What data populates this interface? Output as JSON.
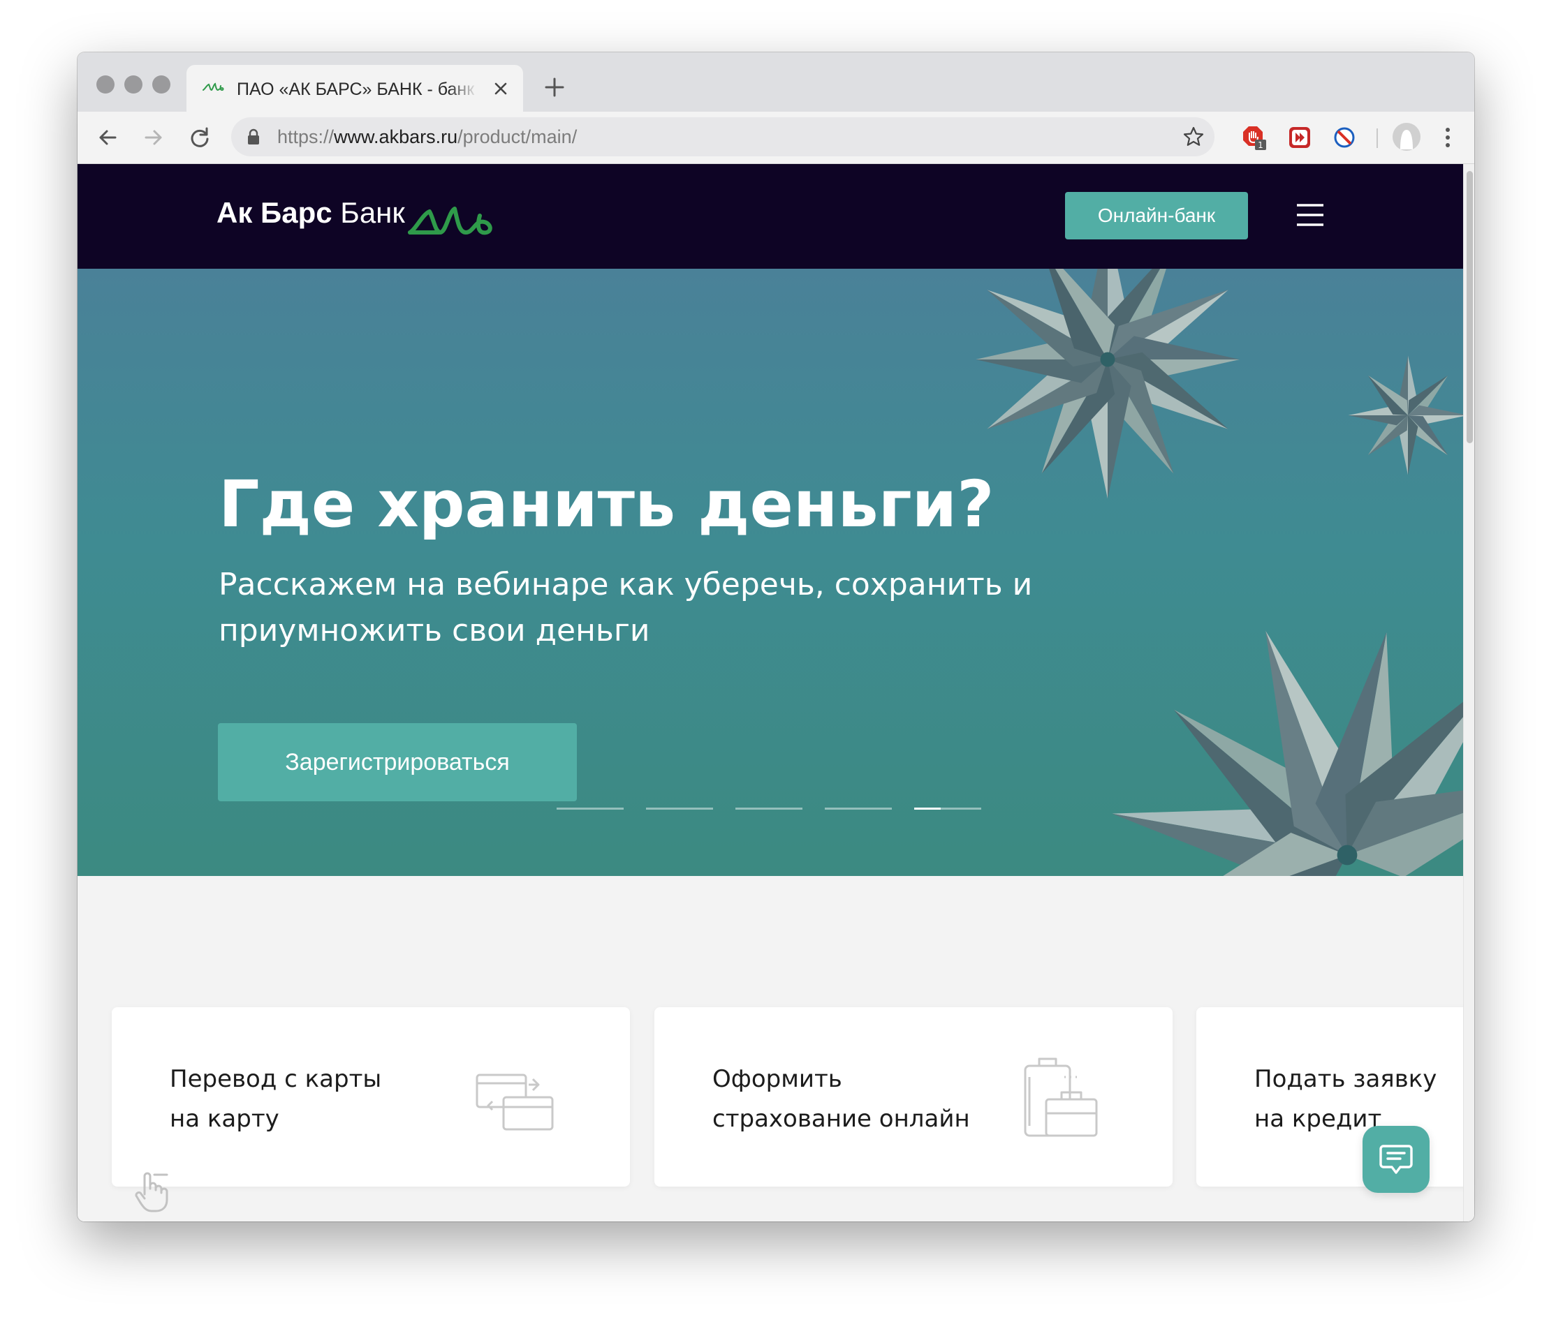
{
  "browser": {
    "tab": {
      "title": "ПАО «АК БАРС» БАНК - банк",
      "favicon": "akbars-logo-icon"
    },
    "url": {
      "scheme": "https://",
      "host": "www.akbars.ru",
      "path": "/product/main/"
    },
    "extensions": {
      "ext1_badge": "1"
    }
  },
  "header": {
    "logo_bold": "Ак Барс",
    "logo_light": " Банк",
    "online_bank_label": "Онлайн-банк"
  },
  "hero": {
    "title": "Где хранить деньги?",
    "subtitle": "Расскажем на вебинаре как уберечь, сохранить и приумножить свои деньги",
    "register_label": "Зарегистрироваться",
    "slides_count": 5,
    "active_slide": 5,
    "active_slide_progress": 0.4
  },
  "cards": [
    {
      "line1": "Перевод с карты",
      "line2": "на карту",
      "icon": "card-transfer-icon"
    },
    {
      "line1": "Оформить",
      "line2": "страхование онлайн",
      "icon": "luggage-insurance-icon"
    },
    {
      "line1": "Подать заявку",
      "line2": "на кредит",
      "icon": ""
    }
  ],
  "colors": {
    "header_bg": "#0e0425",
    "accent": "#52aea5",
    "logo_green": "#2f9a4a"
  }
}
